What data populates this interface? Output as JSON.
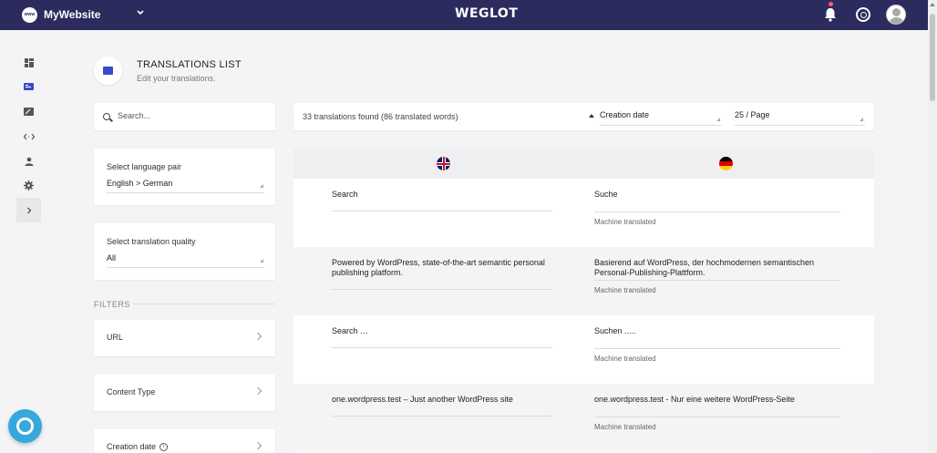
{
  "topbar": {
    "site_logo_text": "www",
    "site_name": "MyWebsite",
    "brand": "WEGLOT"
  },
  "nav": {
    "items": [
      {
        "icon": "dashboard-icon"
      },
      {
        "icon": "translations-icon"
      },
      {
        "icon": "visual-editor-icon"
      },
      {
        "icon": "code-icon"
      },
      {
        "icon": "user-icon"
      },
      {
        "icon": "settings-icon"
      },
      {
        "icon": "chevron-right-icon"
      }
    ]
  },
  "header": {
    "title": "TRANSLATIONS LIST",
    "subtitle": "Edit your translations."
  },
  "search": {
    "placeholder": "Search..."
  },
  "language_pair": {
    "label": "Select language pair",
    "value": "English > German"
  },
  "quality": {
    "label": "Select translation quality",
    "value": "All"
  },
  "filters": {
    "heading": "FILTERS",
    "items": [
      {
        "label": "URL"
      },
      {
        "label": "Content Type"
      },
      {
        "label": "Creation date"
      }
    ]
  },
  "results": {
    "count": "33 translations found (86 translated words)",
    "sort": "Creation date",
    "per_page": "25 / Page"
  },
  "translations": [
    {
      "source": "Search",
      "target": "Suche",
      "status": "Machine translated"
    },
    {
      "source": "Powered by WordPress, state-of-the-art semantic personal publishing platform.",
      "target": "Basierend auf WordPress, der hochmodernen semantischen Personal-Publishing-Plattform.",
      "status": "Machine translated"
    },
    {
      "source": "Search …",
      "target": "Suchen .....",
      "status": "Machine translated"
    },
    {
      "source": "one.wordpress.test – Just another WordPress site",
      "target": "one.wordpress.test - Nur eine weitere WordPress-Seite",
      "status": "Machine translated"
    }
  ],
  "colors": {
    "topbar": "#2c2b5e",
    "accent": "#3a4bc8",
    "help_bubble": "#36a8de",
    "notification": "#ff5c63"
  }
}
